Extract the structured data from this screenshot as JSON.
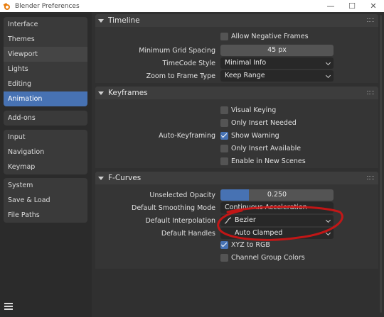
{
  "window": {
    "title": "Blender Preferences",
    "minimize_glyph": "—",
    "maximize_glyph": "☐",
    "close_glyph": "✕"
  },
  "sidebar": {
    "groups": [
      {
        "items": [
          "Interface",
          "Themes",
          "Viewport",
          "Lights",
          "Editing",
          "Animation"
        ]
      },
      {
        "items": [
          "Add-ons"
        ]
      },
      {
        "items": [
          "Input",
          "Navigation",
          "Keymap"
        ]
      },
      {
        "items": [
          "System",
          "Save & Load",
          "File Paths"
        ]
      }
    ],
    "active": "Animation"
  },
  "timeline": {
    "title": "Timeline",
    "allow_negative_frames": {
      "label": "Allow Negative Frames",
      "checked": false
    },
    "min_grid_spacing": {
      "label": "Minimum Grid Spacing",
      "value": "45 px"
    },
    "timecode_style": {
      "label": "TimeCode Style",
      "value": "Minimal Info"
    },
    "zoom_to_frame_type": {
      "label": "Zoom to Frame Type",
      "value": "Keep Range"
    }
  },
  "keyframes": {
    "title": "Keyframes",
    "auto_keyframing_label": "Auto-Keyframing",
    "options": [
      {
        "label": "Visual Keying",
        "checked": false
      },
      {
        "label": "Only Insert Needed",
        "checked": false
      },
      {
        "label": "Show Warning",
        "checked": true
      },
      {
        "label": "Only Insert Available",
        "checked": false
      },
      {
        "label": "Enable in New Scenes",
        "checked": false
      }
    ]
  },
  "fcurves": {
    "title": "F-Curves",
    "unselected_opacity": {
      "label": "Unselected Opacity",
      "value": "0.250",
      "fraction": 0.25
    },
    "default_smoothing_mode": {
      "label": "Default Smoothing Mode",
      "value": "Continuous Acceleration"
    },
    "default_interpolation": {
      "label": "Default Interpolation",
      "value": "Bezier"
    },
    "default_handles": {
      "label": "Default Handles",
      "value": "Auto Clamped"
    },
    "xyz_to_rgb": {
      "label": "XYZ to RGB",
      "checked": true
    },
    "channel_group_colors": {
      "label": "Channel Group Colors",
      "checked": false
    }
  },
  "colors": {
    "accent": "#4772b3",
    "annotation": "#d21414"
  }
}
